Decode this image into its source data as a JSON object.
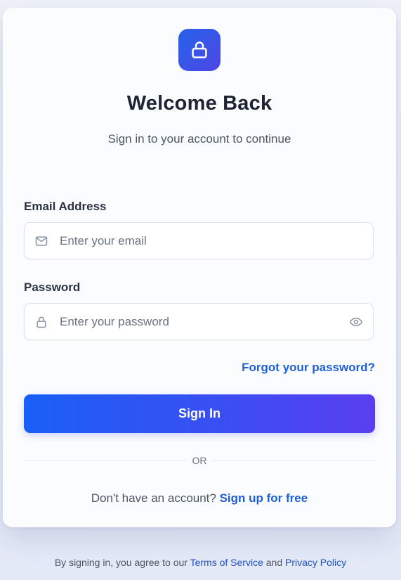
{
  "logo": {
    "icon": "lock-icon",
    "gradient": [
      "#2563eb",
      "#4f46e5"
    ]
  },
  "header": {
    "title": "Welcome Back",
    "subtitle": "Sign in to your account to continue"
  },
  "form": {
    "email": {
      "label": "Email Address",
      "placeholder": "Enter your email",
      "value": "",
      "icon": "mail-icon"
    },
    "password": {
      "label": "Password",
      "placeholder": "Enter your password",
      "value": "",
      "icon": "lock-icon",
      "toggle_icon": "eye-icon"
    },
    "forgot_label": "Forgot your password?",
    "submit_label": "Sign In"
  },
  "divider_label": "OR",
  "signup": {
    "prompt": "Don't have an account?",
    "link_label": "Sign up for free"
  },
  "footer": {
    "prefix": "By signing in, you agree to our",
    "terms_label": "Terms of Service",
    "conjunction": "and",
    "privacy_label": "Privacy Policy"
  },
  "colors": {
    "accent": "#1d5fd8",
    "button_gradient": [
      "#1a5ff7",
      "#5a3ef0"
    ],
    "heading": "#1e2433"
  }
}
